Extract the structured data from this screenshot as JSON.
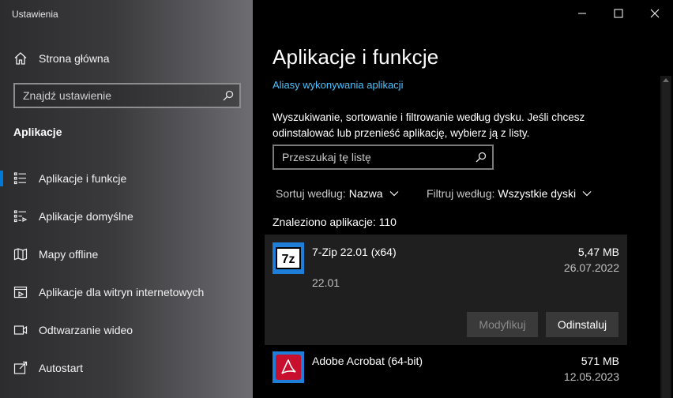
{
  "window": {
    "title": "Ustawienia"
  },
  "sidebar": {
    "home_label": "Strona główna",
    "search_placeholder": "Znajdź ustawienie",
    "section_title": "Aplikacje",
    "items": [
      {
        "label": "Aplikacje i funkcje",
        "icon": "apps-features-icon",
        "selected": true
      },
      {
        "label": "Aplikacje domyślne",
        "icon": "default-apps-icon"
      },
      {
        "label": "Mapy offline",
        "icon": "map-icon"
      },
      {
        "label": "Aplikacje dla witryn internetowych",
        "icon": "web-apps-icon"
      },
      {
        "label": "Odtwarzanie wideo",
        "icon": "video-icon"
      },
      {
        "label": "Autostart",
        "icon": "startup-icon"
      }
    ]
  },
  "main": {
    "title": "Aplikacje i funkcje",
    "alias_link": "Aliasy wykonywania aplikacji",
    "description": "Wyszukiwanie, sortowanie i filtrowanie według dysku. Jeśli chcesz odinstalować lub przenieść aplikację, wybierz ją z listy.",
    "list_search_placeholder": "Przeszukaj tę listę",
    "sort": {
      "label": "Sortuj według:",
      "value": "Nazwa"
    },
    "filter": {
      "label": "Filtruj według:",
      "value": "Wszystkie dyski"
    },
    "found_text": "Znaleziono aplikacje: 110",
    "apps": [
      {
        "name": "7-Zip 22.01 (x64)",
        "size": "5,47 MB",
        "date": "26.07.2022",
        "version": "22.01",
        "icon": "7zip-icon"
      },
      {
        "name": "Adobe Acrobat (64-bit)",
        "size": "571 MB",
        "date": "12.05.2023",
        "icon": "acrobat-icon"
      }
    ],
    "buttons": {
      "modify": "Modyfikuj",
      "uninstall": "Odinstaluj"
    }
  },
  "colors": {
    "accent": "#0078d7",
    "link": "#4cc2ff",
    "acrobat_red": "#c8102e"
  }
}
